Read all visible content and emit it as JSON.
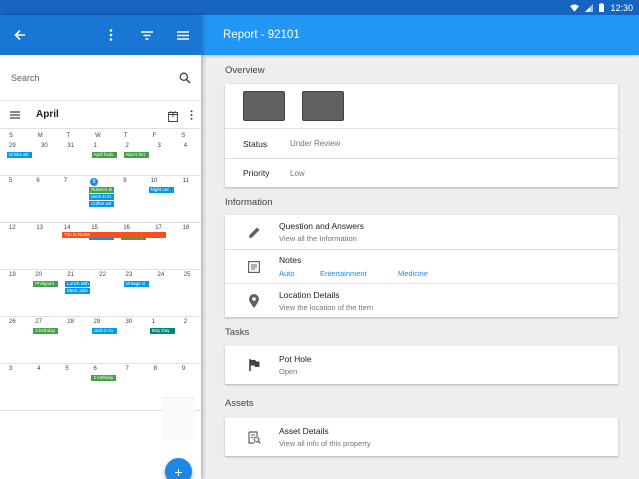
{
  "status_bar": {
    "time": "12:30"
  },
  "left": {
    "search": {
      "placeholder": "Search"
    },
    "calendar": {
      "month": "April",
      "calendar_icon_day": "8",
      "weekdays": [
        "S",
        "M",
        "T",
        "W",
        "T",
        "F",
        "S"
      ],
      "weeks": [
        {
          "days": [
            {
              "n": "29",
              "events": [
                {
                  "t": "Drinks wit",
                  "c": "blue"
                }
              ]
            },
            {
              "n": "30",
              "events": []
            },
            {
              "n": "31",
              "events": []
            },
            {
              "n": "1",
              "events": [
                {
                  "t": "April fools",
                  "c": "green"
                }
              ]
            },
            {
              "n": "2",
              "events": [
                {
                  "t": "Alex's birt",
                  "c": "green"
                }
              ]
            },
            {
              "n": "3",
              "events": []
            },
            {
              "n": "4",
              "events": []
            }
          ]
        },
        {
          "days": [
            {
              "n": "5",
              "events": []
            },
            {
              "n": "6",
              "events": []
            },
            {
              "n": "7",
              "events": []
            },
            {
              "n": "8",
              "today": true,
              "events": [
                {
                  "t": "Ruben's bi",
                  "c": "green"
                },
                {
                  "t": "Mom in to",
                  "c": "blue"
                },
                {
                  "t": "Coffee wit",
                  "c": "blue"
                }
              ]
            },
            {
              "n": "9",
              "events": []
            },
            {
              "n": "10",
              "events": [
                {
                  "t": "Night out",
                  "c": "blue"
                }
              ]
            },
            {
              "n": "11",
              "events": []
            }
          ]
        },
        {
          "days": [
            {
              "n": "12",
              "events": []
            },
            {
              "n": "13",
              "events": []
            },
            {
              "n": "14",
              "events": []
            },
            {
              "n": "15",
              "events": [
                {
                  "t": "Karsh wit",
                  "c": "blue"
                }
              ]
            },
            {
              "n": "16",
              "events": [
                {
                  "t": "2 birthday",
                  "c": "green"
                }
              ]
            },
            {
              "n": "17",
              "events": []
            },
            {
              "n": "18",
              "events": []
            }
          ],
          "span_event": {
            "t": "Trip to Rome"
          }
        },
        {
          "days": [
            {
              "n": "19",
              "events": []
            },
            {
              "n": "20",
              "events": [
                {
                  "t": "Philippa's",
                  "c": "green"
                }
              ]
            },
            {
              "n": "21",
              "events": [
                {
                  "t": "Lunch with",
                  "c": "blue"
                },
                {
                  "t": "Meet Julie",
                  "c": "blue"
                }
              ]
            },
            {
              "n": "22",
              "events": []
            },
            {
              "n": "23",
              "events": [
                {
                  "t": "Vintage ci",
                  "c": "blue"
                }
              ]
            },
            {
              "n": "24",
              "events": []
            },
            {
              "n": "25",
              "events": []
            }
          ]
        },
        {
          "days": [
            {
              "n": "26",
              "events": []
            },
            {
              "n": "27",
              "events": [
                {
                  "t": "3 birthday",
                  "c": "green"
                }
              ]
            },
            {
              "n": "28",
              "events": []
            },
            {
              "n": "29",
              "events": [
                {
                  "t": "Josh in to",
                  "c": "blue"
                }
              ]
            },
            {
              "n": "30",
              "events": []
            },
            {
              "n": "1",
              "events": [
                {
                  "t": "May Day",
                  "c": "teal"
                }
              ]
            },
            {
              "n": "2",
              "events": []
            }
          ]
        },
        {
          "days": [
            {
              "n": "3",
              "events": []
            },
            {
              "n": "4",
              "events": []
            },
            {
              "n": "5",
              "events": []
            },
            {
              "n": "6",
              "events": [
                {
                  "t": "2 birthday",
                  "c": "green"
                }
              ]
            },
            {
              "n": "7",
              "events": []
            },
            {
              "n": "8",
              "events": []
            },
            {
              "n": "9",
              "events": []
            }
          ]
        }
      ]
    },
    "fab_label": "+"
  },
  "right": {
    "title": "Report - 92101",
    "overview": {
      "heading": "Overview",
      "status_label": "Status",
      "status_value": "Under Review",
      "priority_label": "Priority",
      "priority_value": "Low"
    },
    "information": {
      "heading": "Information",
      "qa_title": "Question and Answers",
      "qa_sub": "View all the Information",
      "notes_title": "Notes",
      "notes_tags": [
        "Auto",
        "Entertainment",
        "Medicine"
      ],
      "location_title": "Location Details",
      "location_sub": "View the location of the Item"
    },
    "tasks": {
      "heading": "Tasks",
      "title": "Pot Hole",
      "sub": "Open"
    },
    "assets": {
      "heading": "Assets",
      "title": "Asset Details",
      "sub": "View all info of this property"
    }
  }
}
